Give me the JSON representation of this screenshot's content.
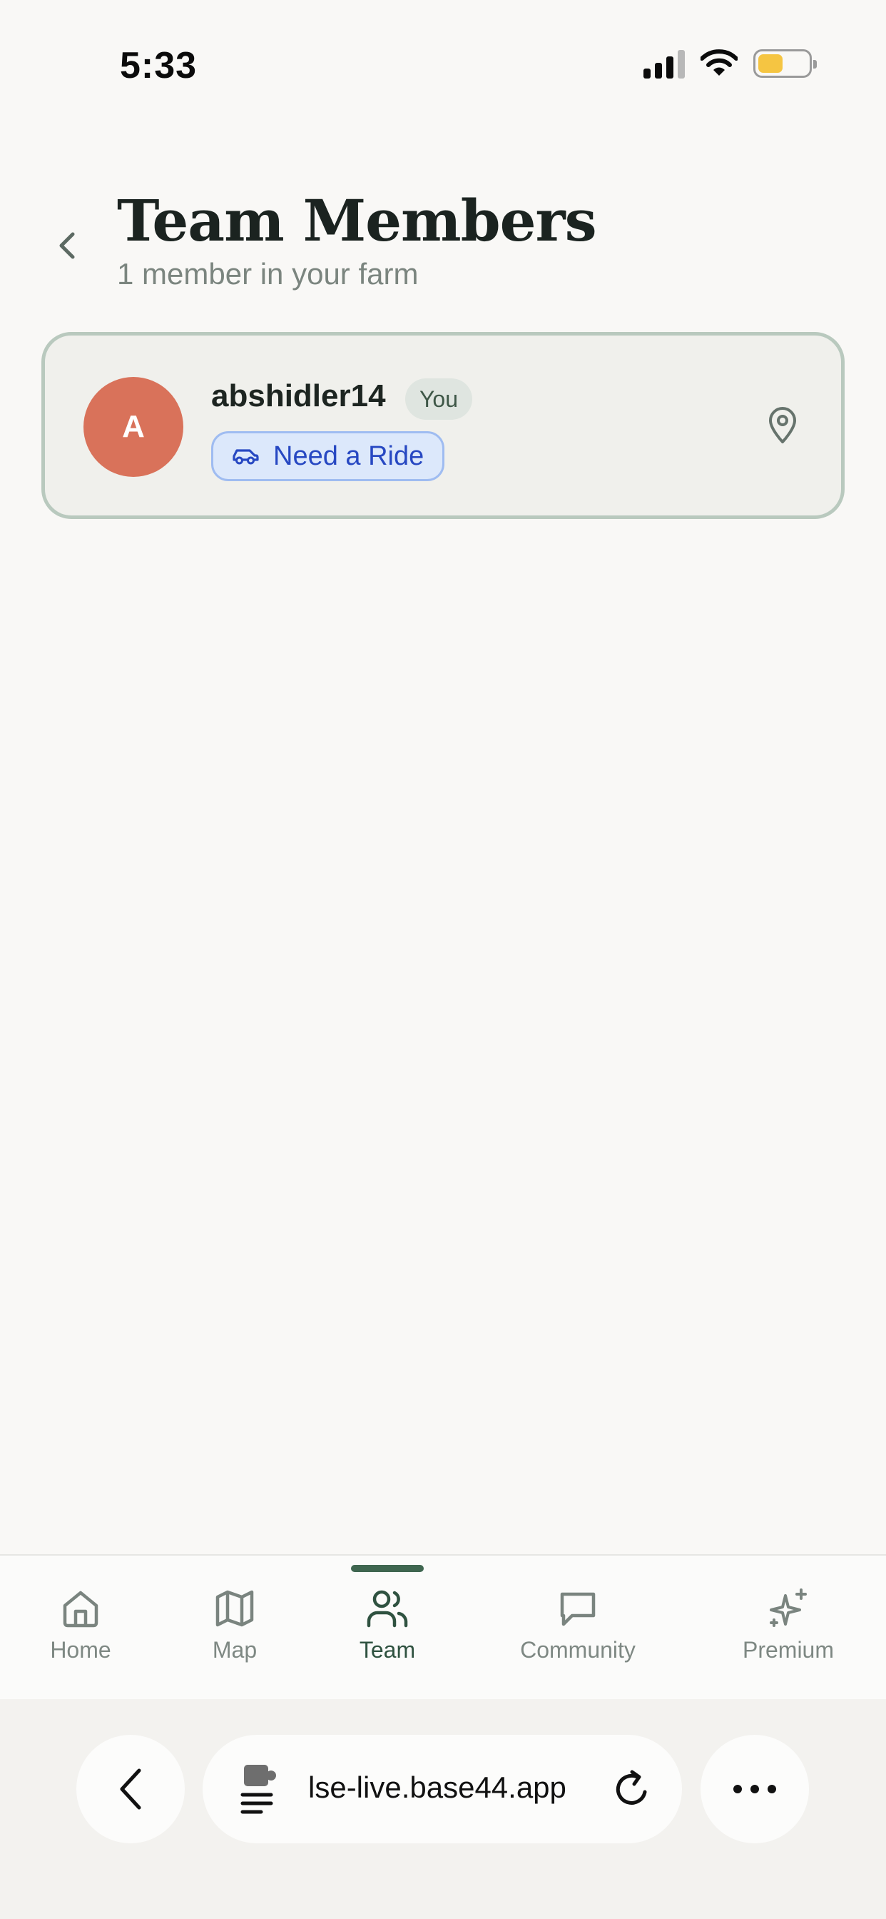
{
  "status_bar": {
    "time": "5:33",
    "icons": [
      "cellular-signal-icon",
      "wifi-icon",
      "battery-icon"
    ],
    "battery_color": "#f5c542"
  },
  "header": {
    "back_icon": "chevron-left-icon",
    "title": "Team Members",
    "subtitle": "1 member in your farm"
  },
  "members": [
    {
      "avatar_initial": "A",
      "avatar_color": "#d9725a",
      "name": "abshidler14",
      "badge": "You",
      "status_icon": "car-icon",
      "status_label": "Need a Ride",
      "action_icon": "map-pin-icon"
    }
  ],
  "tab_bar": {
    "active_tab": "Team",
    "accent_color": "#3f6650",
    "tabs": [
      {
        "label": "Home",
        "icon": "home-icon"
      },
      {
        "label": "Map",
        "icon": "map-icon"
      },
      {
        "label": "Team",
        "icon": "users-icon"
      },
      {
        "label": "Community",
        "icon": "message-square-icon"
      },
      {
        "label": "Premium",
        "icon": "sparkles-icon"
      }
    ]
  },
  "browser": {
    "url": "lse-live.base44.app",
    "back_icon": "chevron-left-icon",
    "extension_icon": "page-extension-icon",
    "reload_icon": "reload-icon",
    "more_icon": "more-horizontal-icon"
  }
}
